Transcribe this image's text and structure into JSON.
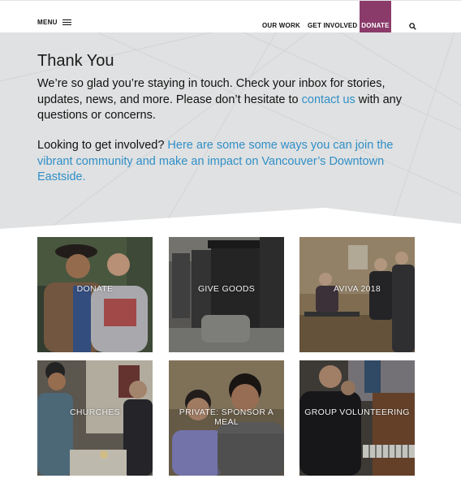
{
  "header": {
    "menu_label": "MENU",
    "nav": {
      "our_work": "OUR WORK",
      "get_involved": "GET INVOLVED",
      "donate": "DONATE"
    },
    "icons": {
      "menu": "hamburger-icon",
      "search": "search-icon"
    },
    "colors": {
      "donate_bg": "#8a3b6a"
    }
  },
  "hero": {
    "title": "Thank You",
    "p1_text": "We’re so glad you’re staying in touch. Check your inbox for stories, updates, news, and more. Please don’t hesitate to ",
    "p1_link": "contact us",
    "p1_tail": " with any questions or concerns.",
    "p2_text": "Looking to get involved? ",
    "p2_link": "Here are some some ways you can join the vibrant community and make an impact on Vancouver’s Downtown Eastside.",
    "colors": {
      "background": "#e0e1e2",
      "link": "#2f8fc7"
    }
  },
  "tiles": [
    {
      "label": "DONATE"
    },
    {
      "label": "GIVE GOODS"
    },
    {
      "label": "AVIVA 2018"
    },
    {
      "label": "CHURCHES"
    },
    {
      "label": "PRIVATE: SPONSOR A MEAL"
    },
    {
      "label": "GROUP VOLUNTEERING"
    }
  ]
}
